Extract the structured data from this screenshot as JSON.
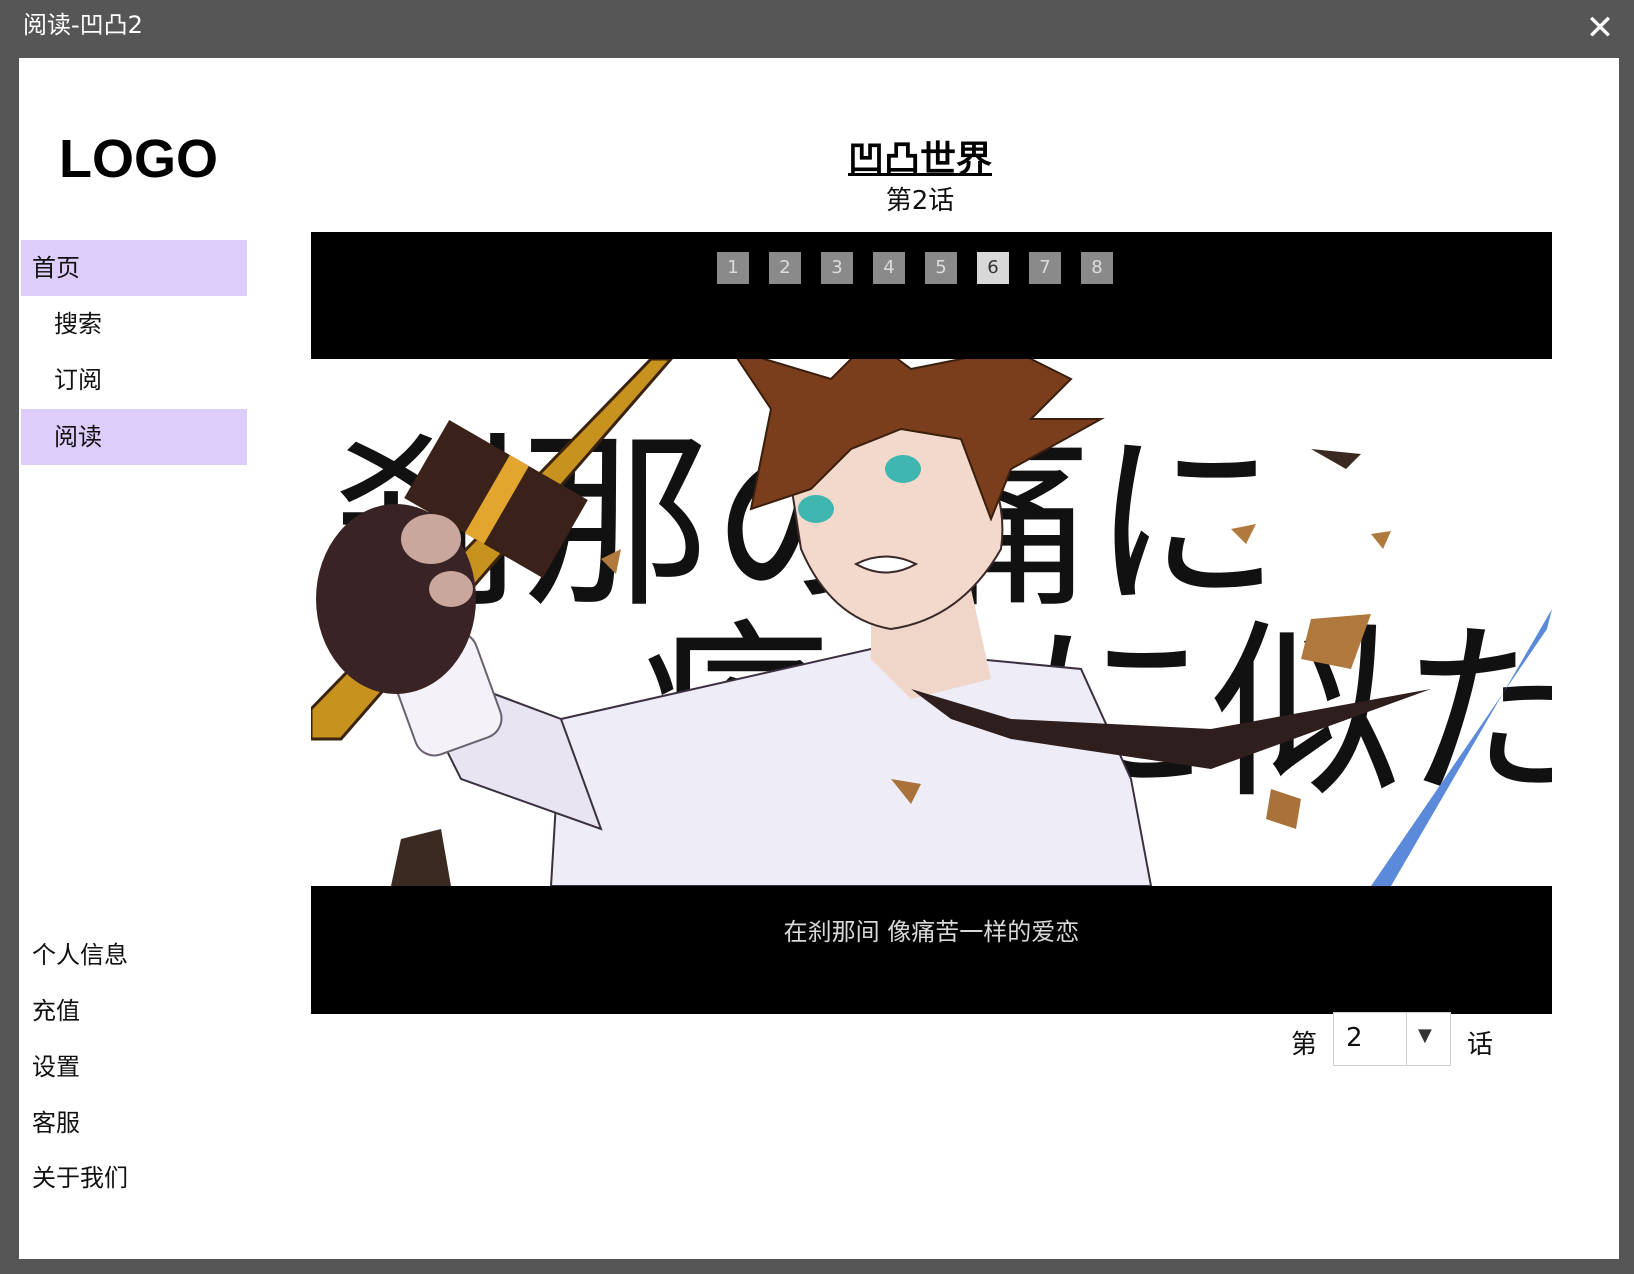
{
  "window": {
    "title": "阅读-凹凸2",
    "close_glyph": "✕"
  },
  "logo": "LOGO",
  "sidebar": {
    "items": [
      {
        "label": "首页"
      },
      {
        "label": "搜索"
      },
      {
        "label": "订阅"
      },
      {
        "label": "阅读"
      }
    ],
    "bottom_items": [
      {
        "label": "个人信息"
      },
      {
        "label": "充值"
      },
      {
        "label": "设置"
      },
      {
        "label": "客服"
      },
      {
        "label": "关于我们"
      }
    ]
  },
  "comic": {
    "title": "凹凸世界",
    "chapter": "第2话"
  },
  "viewer": {
    "pages": [
      "1",
      "2",
      "3",
      "4",
      "5",
      "6",
      "7",
      "8"
    ],
    "current_page": "6",
    "art_text_line1": "刹那の痛に",
    "art_text_line2": "痛みに似た",
    "caption": "在刹那间 像痛苦一样的爱恋"
  },
  "chapter_select": {
    "prefix": "第",
    "value": "2",
    "suffix": "话",
    "arrow": "▼"
  },
  "colors": {
    "active_nav": "#dccdfb",
    "titlebar": "#565656",
    "hair": "#7a3e1c",
    "eyes": "#3fb6b0"
  }
}
